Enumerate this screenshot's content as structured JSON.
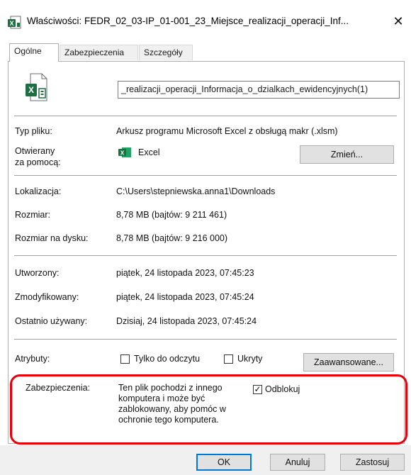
{
  "window": {
    "title": "Właściwości: FEDR_02_03-IP_01-001_23_Miejsce_realizacji_operacji_Inf...",
    "close_glyph": "✕",
    "icon": "excel-file-icon"
  },
  "tabs": [
    {
      "label": "Ogólne",
      "active": true
    },
    {
      "label": "Zabezpieczenia",
      "active": false
    },
    {
      "label": "Szczegóły",
      "active": false
    }
  ],
  "general": {
    "file_icon": "excel-macro-file-icon",
    "file_name": "_realizacji_operacji_Informacja_o_dzialkach_ewidencyjnych(1)",
    "type_label": "Typ pliku:",
    "type_value": "Arkusz programu Microsoft Excel z obsługą makr (.xlsm)",
    "opens_with_label_1": "Otwierany",
    "opens_with_label_2": "za pomocą:",
    "opens_with_app": "Excel",
    "change_button": "Zmień...",
    "location_label": "Lokalizacja:",
    "location_value": "C:\\Users\\stepniewska.anna1\\Downloads",
    "size_label": "Rozmiar:",
    "size_value": "8,78 MB (bajtów: 9 211 461)",
    "size_on_disk_label": "Rozmiar na dysku:",
    "size_on_disk_value": "8,78 MB (bajtów: 9 216 000)",
    "created_label": "Utworzony:",
    "created_value": "piątek, 24 listopada 2023, 07:45:23",
    "modified_label": "Zmodyfikowany:",
    "modified_value": "piątek, 24 listopada 2023, 07:45:24",
    "accessed_label": "Ostatnio używany:",
    "accessed_value": "Dzisiaj, 24 listopada 2023, 07:45:24",
    "attributes_label": "Atrybuty:",
    "readonly_label": "Tylko do odczytu",
    "readonly_checked": false,
    "hidden_label": "Ukryty",
    "hidden_checked": false,
    "advanced_button": "Zaawansowane...",
    "security_label": "Zabezpieczenia:",
    "security_text_1": "Ten plik pochodzi z innego",
    "security_text_2": "komputera i może być",
    "security_text_3": "zablokowany, aby pomóc w",
    "security_text_4": "ochronie tego komputera.",
    "unblock_label": "Odblokuj",
    "unblock_checked": true,
    "check_glyph": "✓"
  },
  "buttons": {
    "ok": "OK",
    "cancel": "Anuluj",
    "apply": "Zastosuj"
  },
  "colors": {
    "highlight": "#e8000b",
    "excel_green": "#1d6f42",
    "default_button_border": "#0078d7"
  }
}
